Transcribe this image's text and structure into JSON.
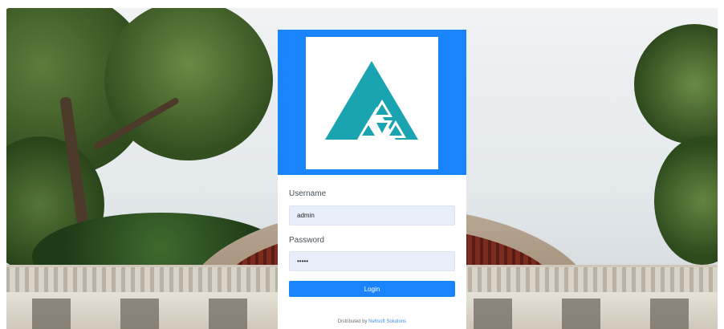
{
  "login": {
    "username_label": "Username",
    "username_value": "admin",
    "password_label": "Password",
    "password_value": "admin",
    "login_button": "Login",
    "footer_text": "Distributed by ",
    "footer_link": "Nehsoft Solutions"
  },
  "colors": {
    "accent": "#1a84ff",
    "logo_teal": "#1aa3b0",
    "input_bg": "#e8effa"
  },
  "icons": {
    "logo": "triangle-logo-icon"
  }
}
